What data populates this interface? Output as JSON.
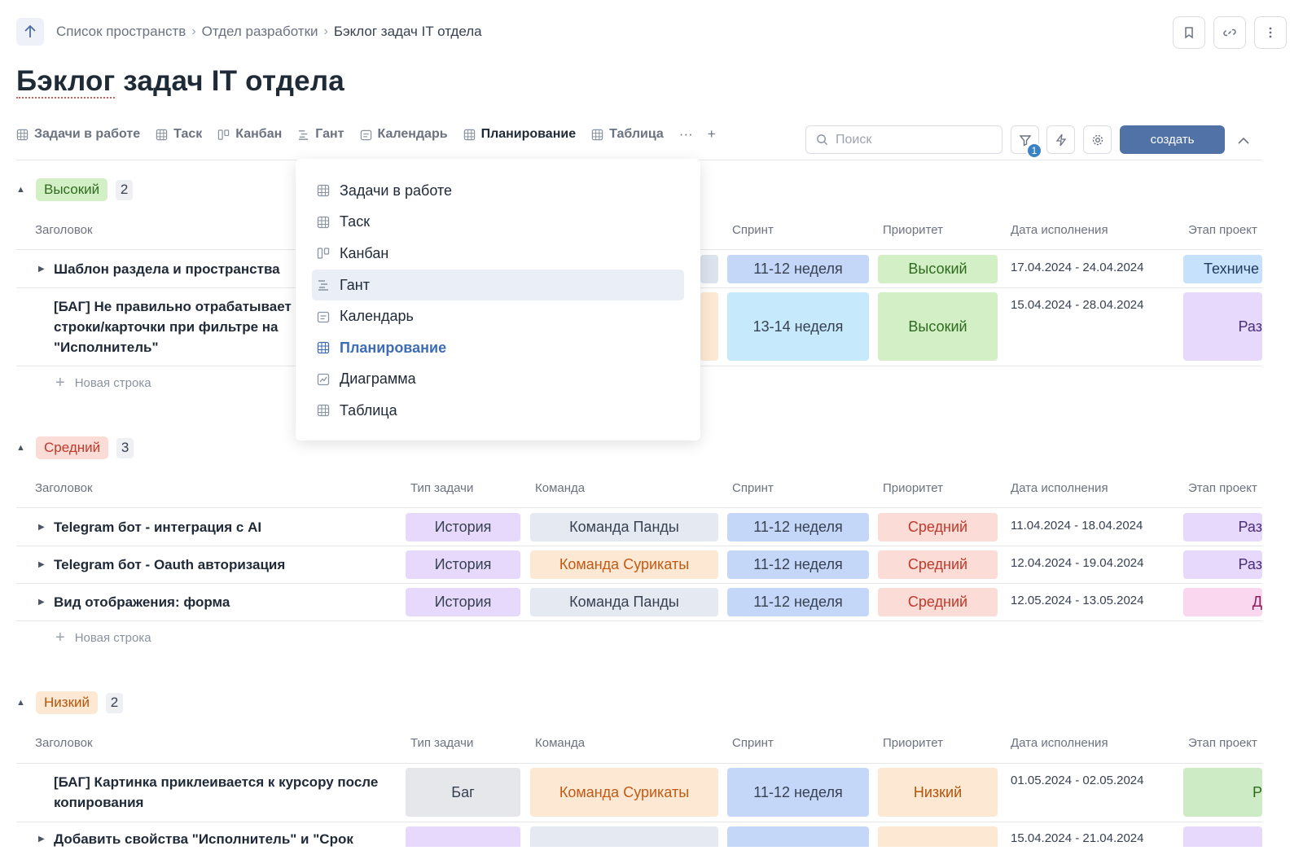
{
  "breadcrumb": {
    "items": [
      "Список пространств",
      "Отдел разработки",
      "Бэклог задач IT отдела"
    ],
    "separator": "›"
  },
  "page": {
    "title_part1": "Бэклог",
    "title_part2": " задач IT отдела"
  },
  "tabs": [
    {
      "label": "Задачи в работе",
      "icon": "table-icon"
    },
    {
      "label": "Таск",
      "icon": "table-icon"
    },
    {
      "label": "Канбан",
      "icon": "kanban-icon"
    },
    {
      "label": "Гант",
      "icon": "gantt-icon"
    },
    {
      "label": "Календарь",
      "icon": "calendar-icon"
    },
    {
      "label": "Планирование",
      "icon": "table-icon",
      "active": true
    },
    {
      "label": "Таблица",
      "icon": "table-icon"
    }
  ],
  "tab_more": "···",
  "tab_add": "+",
  "search": {
    "placeholder": "Поиск"
  },
  "filter_count": "1",
  "create_label": "создать",
  "dropdown": {
    "items": [
      {
        "label": "Задачи в работе",
        "icon": "table-icon"
      },
      {
        "label": "Таск",
        "icon": "table-icon"
      },
      {
        "label": "Канбан",
        "icon": "kanban-icon"
      },
      {
        "label": "Гант",
        "icon": "gantt-icon",
        "hover": true
      },
      {
        "label": "Календарь",
        "icon": "calendar-icon"
      },
      {
        "label": "Планирование",
        "icon": "table-icon",
        "active": true
      },
      {
        "label": "Диаграмма",
        "icon": "chart-icon"
      },
      {
        "label": "Таблица",
        "icon": "table-icon"
      }
    ]
  },
  "columns": {
    "title": "Заголовок",
    "type": "Тип задачи",
    "team": "Команда",
    "sprint": "Спринт",
    "priority": "Приоритет",
    "due": "Дата исполнения",
    "stage": "Этап проект"
  },
  "new_row": "Новая строка",
  "colors": {
    "story": "#e6d9fb",
    "bug": "#e5e7eb",
    "team_panda": "#e5e9f2",
    "team_meerkat": "#fde9d3",
    "sprint_a": "#c4d7f8",
    "sprint_b": "#c6e9fb",
    "high": "#d3efc5",
    "medium": "#fbdcd6",
    "low": "#fde9d3",
    "stage_tech": "#c6e1fb",
    "stage_dev": "#e6d9fb",
    "stage_pink": "#fbd6ef",
    "stage_green": "#cdebc4"
  },
  "groups": [
    {
      "name": "Высокий",
      "count": "2",
      "pill_bg": "#d3efc5",
      "pill_fg": "#2f6b1f",
      "rows": [
        {
          "title": "Шаблон раздела и пространства",
          "caret": true,
          "sprint": "11-12 неделя",
          "sprint_bg": "#c4d7f8",
          "priority": "Высокий",
          "priority_bg": "#d3efc5",
          "priority_fg": "#2f6b1f",
          "due": "17.04.2024 - 24.04.2024",
          "stage": "Техниче",
          "stage_bg": "#c6e1fb"
        },
        {
          "title": "[БАГ] Не правильно отрабатывает",
          "title2": "строки/карточки при фильтре на",
          "title3": "\"Исполнитель\"",
          "caret": false,
          "sprint": "13-14 неделя",
          "sprint_bg": "#c6e9fb",
          "priority": "Высокий",
          "priority_bg": "#d3efc5",
          "priority_fg": "#2f6b1f",
          "due": "15.04.2024 - 28.04.2024",
          "stage": "Раз",
          "stage_bg": "#e6d9fb"
        }
      ]
    },
    {
      "name": "Средний",
      "count": "3",
      "pill_bg": "#fbdcd6",
      "pill_fg": "#c0392b",
      "rows": [
        {
          "title": "Telegram бот - интеграция с AI",
          "type": "История",
          "team": "Команда Панды",
          "team_bg": "#e5e9f2",
          "team_fg": "#374151",
          "sprint": "11-12 неделя",
          "priority": "Средний",
          "due": "11.04.2024 - 18.04.2024",
          "stage": "Раз",
          "stage_bg": "#e6d9fb"
        },
        {
          "title": "Telegram бот - Oauth авторизация",
          "type": "История",
          "team": "Команда Сурикаты",
          "team_bg": "#fde9d3",
          "team_fg": "#c25a16",
          "sprint": "11-12 неделя",
          "priority": "Средний",
          "due": "12.04.2024 - 19.04.2024",
          "stage": "Раз",
          "stage_bg": "#e6d9fb"
        },
        {
          "title": "Вид отображения: форма",
          "type": "История",
          "team": "Команда Панды",
          "team_bg": "#e5e9f2",
          "team_fg": "#374151",
          "sprint": "11-12 неделя",
          "priority": "Средний",
          "due": "12.05.2024 - 13.05.2024",
          "stage": "Д",
          "stage_bg": "#fbd6ef"
        }
      ]
    },
    {
      "name": "Низкий",
      "count": "2",
      "pill_bg": "#fde9d3",
      "pill_fg": "#b45309",
      "rows": [
        {
          "title": "[БАГ] Картинка приклеивается к курсору после",
          "title2": "копирования",
          "type": "Баг",
          "team": "Команда Сурикаты",
          "sprint": "11-12 неделя",
          "priority": "Низкий",
          "due": "01.05.2024 - 02.05.2024",
          "stage": "Р",
          "stage_bg": "#cdebc4"
        },
        {
          "title": "Добавить свойства \"Исполнитель\" и \"Срок",
          "due": "15.04.2024 - 21.04.2024"
        }
      ]
    }
  ]
}
